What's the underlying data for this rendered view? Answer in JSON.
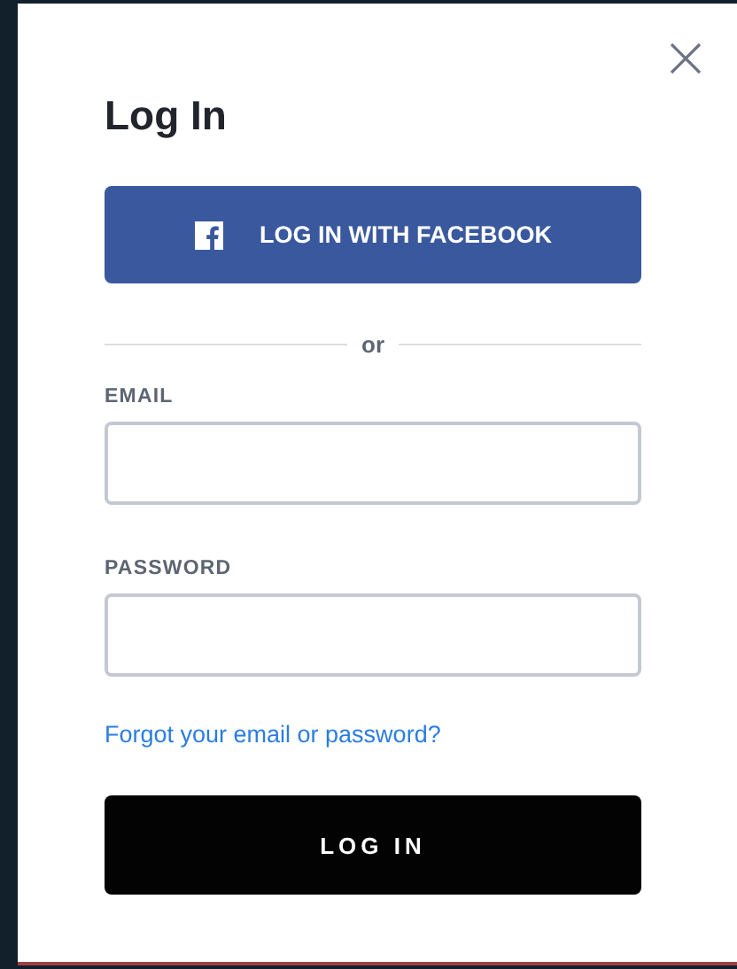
{
  "dialog": {
    "title": "Log In"
  },
  "facebook_button": {
    "label": "LOG IN WITH FACEBOOK"
  },
  "divider": {
    "label": "or"
  },
  "fields": [
    {
      "label": "EMAIL"
    },
    {
      "label": "PASSWORD"
    }
  ],
  "forgot_link": "Forgot your email or password?",
  "submit_button": {
    "label": "LOG IN"
  }
}
